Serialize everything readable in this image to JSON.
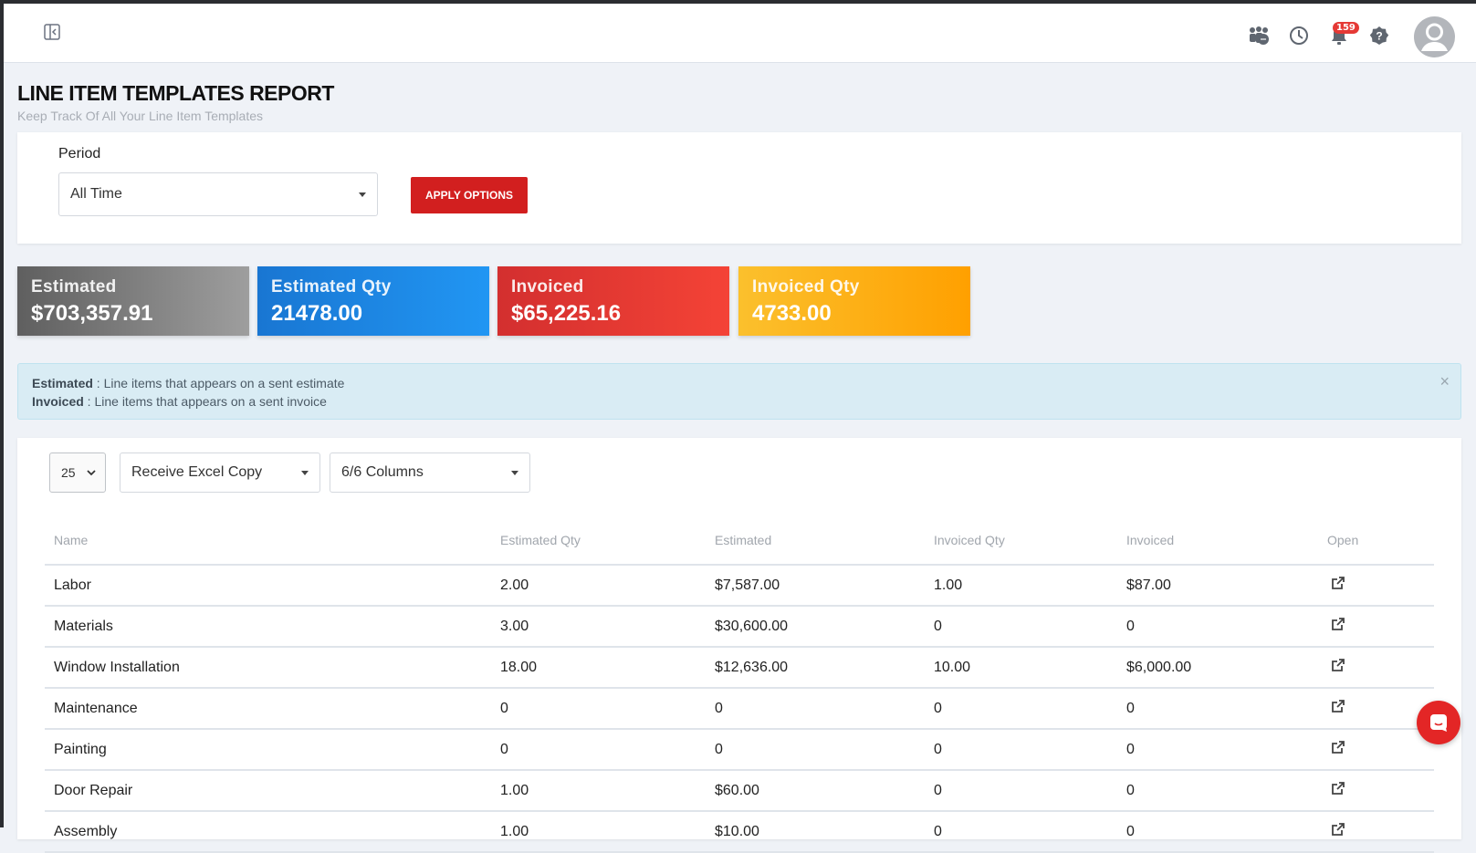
{
  "header": {
    "notification_count": "159"
  },
  "page": {
    "title": "LINE ITEM TEMPLATES REPORT",
    "subtitle": "Keep Track Of All Your Line Item Templates"
  },
  "filters": {
    "period_label": "Period",
    "period_value": "All Time",
    "apply_label": "APPLY OPTIONS"
  },
  "stats": [
    {
      "label": "Estimated",
      "value": "$703,357.91"
    },
    {
      "label": "Estimated Qty",
      "value": "21478.00"
    },
    {
      "label": "Invoiced",
      "value": "$65,225.16"
    },
    {
      "label": "Invoiced Qty",
      "value": "4733.00"
    }
  ],
  "info": {
    "line1_term": "Estimated",
    "line1_text": " : Line items that appears on a sent estimate",
    "line2_term": "Invoiced",
    "line2_text": " : Line items that appears on a sent invoice",
    "close": "×"
  },
  "table_controls": {
    "page_size": "25",
    "export": "Receive Excel Copy",
    "columns": "6/6 Columns"
  },
  "table": {
    "headers": [
      "Name",
      "Estimated Qty",
      "Estimated",
      "Invoiced Qty",
      "Invoiced",
      "Open"
    ],
    "rows": [
      [
        "Labor",
        "2.00",
        "$7,587.00",
        "1.00",
        "$87.00"
      ],
      [
        "Materials",
        "3.00",
        "$30,600.00",
        "0",
        "0"
      ],
      [
        "Window Installation",
        "18.00",
        "$12,636.00",
        "10.00",
        "$6,000.00"
      ],
      [
        "Maintenance",
        "0",
        "0",
        "0",
        "0"
      ],
      [
        "Painting",
        "0",
        "0",
        "0",
        "0"
      ],
      [
        "Door Repair",
        "1.00",
        "$60.00",
        "0",
        "0"
      ],
      [
        "Assembly",
        "1.00",
        "$10.00",
        "0",
        "0"
      ]
    ]
  }
}
